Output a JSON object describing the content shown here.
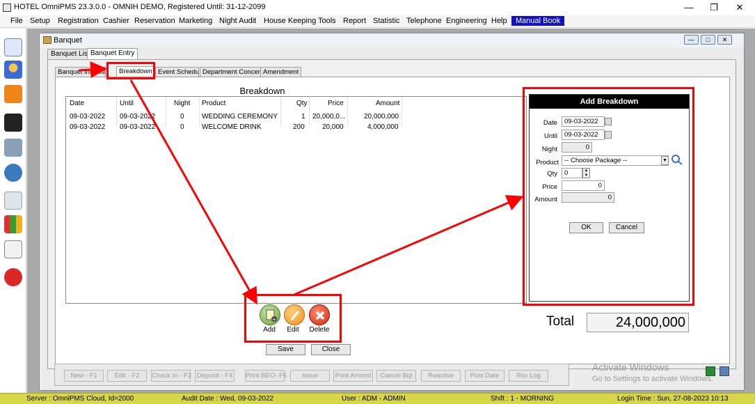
{
  "window": {
    "title": "HOTEL OmniPMS 23.3.0.0 - OMNIH DEMO, Registered Until: 31-12-2099"
  },
  "menu": [
    "File",
    "Setup",
    "Registration",
    "Cashier",
    "Reservation",
    "Marketing",
    "Night Audit",
    "House Keeping",
    "Tools",
    "Report",
    "Statistic",
    "Telephone",
    "Engineering",
    "Help",
    "Manual Book"
  ],
  "banquet": {
    "title": "Banquet",
    "tabs": [
      "Banquet List",
      "Banquet Entry"
    ],
    "subtabs": [
      "Banquet Informatic",
      "Breakdown",
      "Event Schedule",
      "Department Concern",
      "Amendment"
    ],
    "breakdown_title": "Breakdown",
    "columns": [
      "Date",
      "Until",
      "Night",
      "Product",
      "Qty",
      "Price",
      "Amount"
    ],
    "rows": [
      [
        "09-03-2022",
        "09-03-2022",
        "0",
        "WEDDING CEREMONY",
        "1",
        "20,000,0...",
        "20,000,000"
      ],
      [
        "09-03-2022",
        "09-03-2022",
        "0",
        "WELCOME DRINK",
        "200",
        "20,000",
        "4,000,000"
      ]
    ],
    "actions": {
      "add": "Add",
      "edit": "Edit",
      "delete": "Delete"
    },
    "total_label": "Total",
    "total_value": "24,000,000",
    "save": "Save",
    "close": "Close"
  },
  "dialog": {
    "title": "Add Breakdown",
    "labels": {
      "date": "Date",
      "until": "Until",
      "night": "Night",
      "product": "Product",
      "qty": "Qty",
      "price": "Price",
      "amount": "Amount"
    },
    "values": {
      "date": "09-03-2022",
      "until": "09-03-2022",
      "night": "0",
      "product": "-- Choose Package --",
      "qty": "0",
      "price": "0",
      "amount": "0"
    },
    "ok": "OK",
    "cancel": "Cancel"
  },
  "toolbar": [
    "New - F1",
    "Edit - F2",
    "Check In - F3",
    "Deposit - F4",
    "Print BEO- F6",
    "Issue",
    "Print Amend",
    "Cancel Bqt",
    "Reactive",
    "Post Date",
    "Rsv Log"
  ],
  "watermark": {
    "line1": "Activate Windows",
    "line2": "Go to Settings to activate Windows."
  },
  "status": {
    "server": "Server : OmniPMS Cloud, Id=2000",
    "audit": "Audit Date : Wed, 09-03-2022",
    "user": "User : ADM - ADMIN",
    "shift": "Shift : 1 - MORNING",
    "login": "Login Time : Sun, 27-08-2023 10:13"
  },
  "colors": {
    "accent_red": "#ff0000",
    "menu_active": "#1010c8",
    "status_bg": "#d6d648"
  }
}
